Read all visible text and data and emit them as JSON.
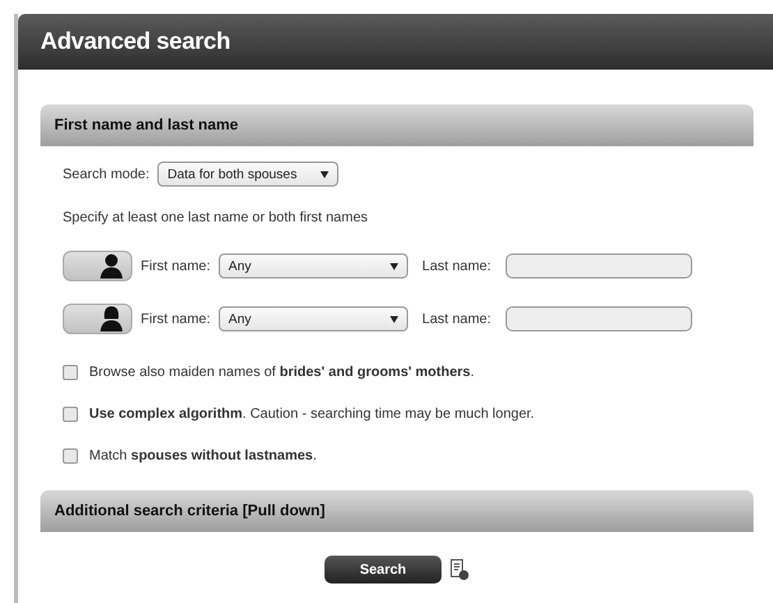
{
  "window": {
    "title": "Advanced search"
  },
  "name_section": {
    "title": "First name and last name",
    "search_mode": {
      "label": "Search mode:",
      "value": "Data for both spouses"
    },
    "hint": "Specify at least one last name or both first names",
    "spouses": [
      {
        "kind": "male",
        "on": true,
        "first_name_label": "First name:",
        "first_name_value": "Any",
        "last_name_label": "Last name:"
      },
      {
        "kind": "female",
        "on": true,
        "first_name_label": "First name:",
        "first_name_value": "Any",
        "last_name_label": "Last name:"
      }
    ],
    "options": [
      {
        "label": "Browse also maiden names of **brides' and grooms' mothers**.",
        "checked": false
      },
      {
        "label": "**Use complex algorithm**. Caution - searching time may be much longer.",
        "checked": false
      },
      {
        "label": "Match **spouses without lastnames**.",
        "checked": false
      }
    ]
  },
  "additional_section": {
    "title": "Additional search criteria [Pull down]"
  },
  "search_button": "Search"
}
